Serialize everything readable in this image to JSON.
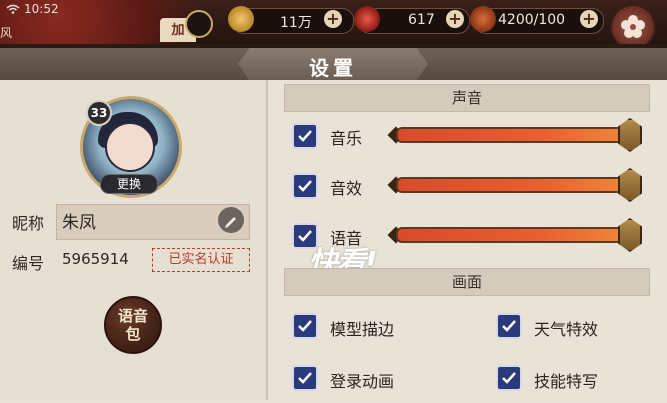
{
  "status_bar": {
    "time": "10:52"
  },
  "top_left_text": "风",
  "plus_tab": "加",
  "resources": [
    {
      "icon": "gold-coin-icon",
      "value": "11万"
    },
    {
      "icon": "red-jade-icon",
      "value": "617"
    },
    {
      "icon": "stamina-icon",
      "value": "4200/100"
    }
  ],
  "title": "设置",
  "profile": {
    "level": "33",
    "change_label": "更换",
    "nickname_label": "昵称",
    "nickname": "朱凤",
    "id_label": "编号",
    "id_value": "5965914",
    "verified": "已实名认证",
    "voice_pack": "语音包"
  },
  "sound": {
    "header": "声音",
    "rows": [
      {
        "label": "音乐",
        "checked": true,
        "level": 1.0
      },
      {
        "label": "音效",
        "checked": true,
        "level": 1.0
      },
      {
        "label": "语音",
        "checked": true,
        "level": 1.0
      }
    ]
  },
  "graphics": {
    "header": "画面",
    "options": [
      {
        "label": "模型描边",
        "checked": true
      },
      {
        "label": "天气特效",
        "checked": true
      },
      {
        "label": "登录动画",
        "checked": true
      },
      {
        "label": "技能特写",
        "checked": true
      }
    ]
  },
  "watermark": "快看!"
}
